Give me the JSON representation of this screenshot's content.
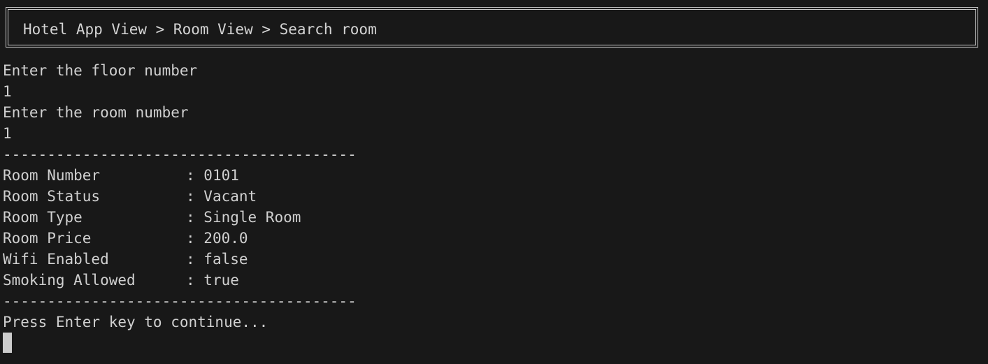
{
  "header": {
    "breadcrumb": "Hotel App View > Room View > Search room"
  },
  "console": {
    "prompt_floor": "Enter the floor number",
    "input_floor": "1",
    "prompt_room": "Enter the room number",
    "input_room": "1",
    "divider_top": "----------------------------------------",
    "fields": [
      {
        "label": "Room Number",
        "value": "0101"
      },
      {
        "label": "Room Status",
        "value": "Vacant"
      },
      {
        "label": "Room Type",
        "value": "Single Room"
      },
      {
        "label": "Room Price",
        "value": "200.0"
      },
      {
        "label": "Wifi Enabled",
        "value": "false"
      },
      {
        "label": "Smoking Allowed",
        "value": "true"
      }
    ],
    "separator": ": ",
    "divider_bottom": "----------------------------------------",
    "continue_prompt": "Press Enter key to continue..."
  },
  "colors": {
    "background": "#181818",
    "foreground": "#cccccc"
  }
}
